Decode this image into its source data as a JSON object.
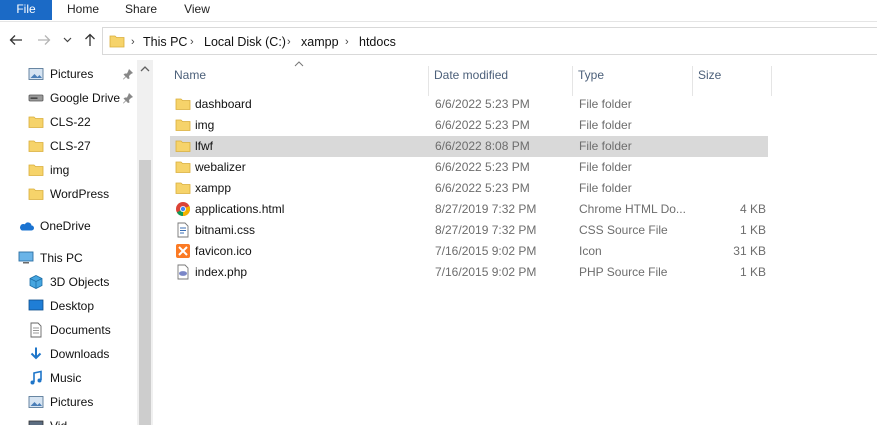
{
  "ribbon": {
    "tabs": [
      "File",
      "Home",
      "Share",
      "View"
    ]
  },
  "address": {
    "crumbs": [
      "This PC",
      "Local Disk (C:)",
      "xampp",
      "htdocs"
    ]
  },
  "nav_pane": {
    "items": [
      {
        "label": "Pictures",
        "icon": "pictures-icon",
        "pinned": true
      },
      {
        "label": "Google Drive",
        "icon": "drive-icon",
        "pinned": true
      },
      {
        "label": "CLS-22",
        "icon": "folder-icon",
        "pinned": false
      },
      {
        "label": "CLS-27",
        "icon": "folder-icon",
        "pinned": false
      },
      {
        "label": "img",
        "icon": "folder-icon",
        "pinned": false
      },
      {
        "label": "WordPress",
        "icon": "folder-icon",
        "pinned": false
      },
      {
        "label": "OneDrive",
        "icon": "onedrive-icon",
        "pinned": false
      },
      {
        "label": "This PC",
        "icon": "this-pc-icon",
        "pinned": false
      },
      {
        "label": "3D Objects",
        "icon": "3d-objects-icon",
        "pinned": false
      },
      {
        "label": "Desktop",
        "icon": "desktop-icon",
        "pinned": false
      },
      {
        "label": "Documents",
        "icon": "documents-icon",
        "pinned": false
      },
      {
        "label": "Downloads",
        "icon": "downloads-icon",
        "pinned": false
      },
      {
        "label": "Music",
        "icon": "music-icon",
        "pinned": false
      },
      {
        "label": "Pictures",
        "icon": "pictures-icon",
        "pinned": false
      },
      {
        "label": "Vid",
        "icon": "videos-icon",
        "pinned": false
      }
    ]
  },
  "columns": {
    "name": "Name",
    "date": "Date modified",
    "type": "Type",
    "size": "Size"
  },
  "files": [
    {
      "name": "dashboard",
      "date": "6/6/2022 5:23 PM",
      "type": "File folder",
      "size": "",
      "icon": "folder-icon",
      "selected": false
    },
    {
      "name": "img",
      "date": "6/6/2022 5:23 PM",
      "type": "File folder",
      "size": "",
      "icon": "folder-icon",
      "selected": false
    },
    {
      "name": "lfwf",
      "date": "6/6/2022 8:08 PM",
      "type": "File folder",
      "size": "",
      "icon": "folder-icon",
      "selected": true
    },
    {
      "name": "webalizer",
      "date": "6/6/2022 5:23 PM",
      "type": "File folder",
      "size": "",
      "icon": "folder-icon",
      "selected": false
    },
    {
      "name": "xampp",
      "date": "6/6/2022 5:23 PM",
      "type": "File folder",
      "size": "",
      "icon": "folder-icon",
      "selected": false
    },
    {
      "name": "applications.html",
      "date": "8/27/2019 7:32 PM",
      "type": "Chrome HTML Do...",
      "size": "4 KB",
      "icon": "chrome-icon",
      "selected": false
    },
    {
      "name": "bitnami.css",
      "date": "8/27/2019 7:32 PM",
      "type": "CSS Source File",
      "size": "1 KB",
      "icon": "css-file-icon",
      "selected": false
    },
    {
      "name": "favicon.ico",
      "date": "7/16/2015 9:02 PM",
      "type": "Icon",
      "size": "31 KB",
      "icon": "xampp-icon",
      "selected": false
    },
    {
      "name": "index.php",
      "date": "7/16/2015 9:02 PM",
      "type": "PHP Source File",
      "size": "1 KB",
      "icon": "php-file-icon",
      "selected": false
    }
  ],
  "colors": {
    "accent": "#1b6ac6",
    "folder": "#f6d36a",
    "selected_row": "#d9d9d9"
  }
}
